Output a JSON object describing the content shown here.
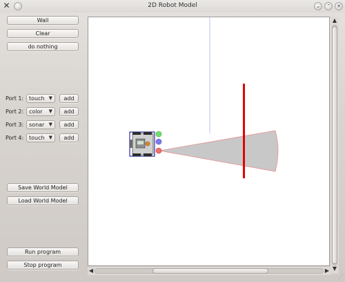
{
  "window": {
    "title": "2D Robot Model",
    "app_icon": "x-logo-icon",
    "controls": [
      "minimize-icon",
      "maximize-icon",
      "close-icon"
    ]
  },
  "sidebar": {
    "top_buttons": [
      {
        "label": "Wall"
      },
      {
        "label": "Clear"
      },
      {
        "label": "do nothing"
      }
    ],
    "ports": [
      {
        "label": "Port 1:",
        "sensor": "touch",
        "add_label": "add"
      },
      {
        "label": "Port 2:",
        "sensor": "color",
        "add_label": "add"
      },
      {
        "label": "Port 3:",
        "sensor": "sonar",
        "add_label": "add"
      },
      {
        "label": "Port 4:",
        "sensor": "touch",
        "add_label": "add"
      }
    ],
    "world_buttons": [
      {
        "label": "Save World Model"
      },
      {
        "label": "Load World Model"
      }
    ],
    "program_buttons": [
      {
        "label": "Run program"
      },
      {
        "label": "Stop program"
      }
    ]
  },
  "canvas": {
    "background": "#ffffff",
    "wall_color": "#e00000",
    "guide_line_color": "#b8c0f0",
    "sonar_cone_fill": "#c8c8c8",
    "sonar_cone_stroke": "#e89090",
    "robot_outline_color": "#2a2aa0",
    "sensor_dots": [
      {
        "name": "touch-sensor-dot",
        "color": "#6de06d"
      },
      {
        "name": "color-sensor-dot",
        "color": "#7b7bef"
      },
      {
        "name": "sonar-sensor-dot",
        "color": "#ef7070"
      }
    ]
  },
  "scrollbars": {
    "icons": {
      "up": "arrow-up-icon",
      "down": "arrow-down-icon",
      "left": "arrow-left-icon",
      "right": "arrow-right-icon"
    }
  }
}
